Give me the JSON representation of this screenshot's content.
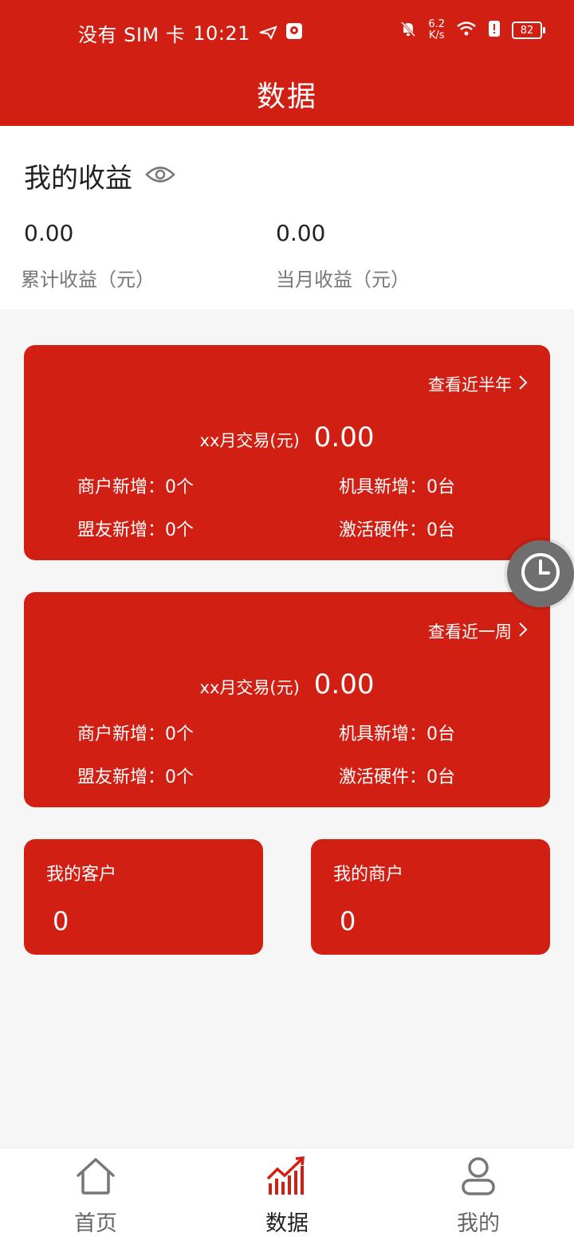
{
  "status_bar": {
    "carrier": "没有 SIM 卡",
    "time": "10:21",
    "net_speed_value": "6.2",
    "net_speed_unit": "K/s",
    "battery": "82"
  },
  "header": {
    "title": "数据"
  },
  "earnings": {
    "title": "我的收益",
    "cumulative": {
      "value": "0.00",
      "label": "累计收益（元）"
    },
    "monthly": {
      "value": "0.00",
      "label": "当月收益（元）"
    }
  },
  "cards": [
    {
      "link": "查看近半年",
      "tx_label": "xx月交易(元)",
      "tx_value": "0.00",
      "merchant_new": "商户新增：0个",
      "device_new": "机具新增：0台",
      "ally_new": "盟友新增：0个",
      "activated": "激活硬件：0台"
    },
    {
      "link": "查看近一周",
      "tx_label": "xx月交易(元)",
      "tx_value": "0.00",
      "merchant_new": "商户新增：0个",
      "device_new": "机具新增：0台",
      "ally_new": "盟友新增：0个",
      "activated": "激活硬件：0台"
    }
  ],
  "my_customers": {
    "title": "我的客户",
    "value": "0"
  },
  "my_merchants": {
    "title": "我的商户",
    "value": "0"
  },
  "bottom_nav": [
    {
      "label": "首页",
      "icon": "home-icon"
    },
    {
      "label": "数据",
      "icon": "chart-icon"
    },
    {
      "label": "我的",
      "icon": "user-icon"
    }
  ],
  "colors": {
    "brand": "#d21f14",
    "background": "#f6f6f7"
  }
}
